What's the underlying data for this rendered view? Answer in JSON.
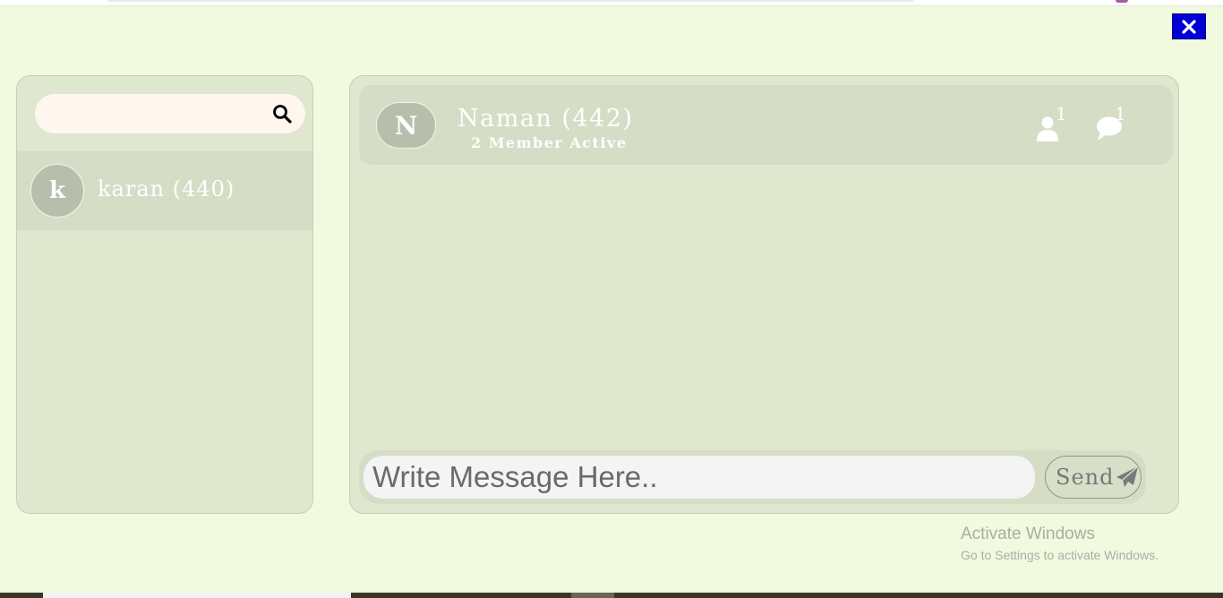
{
  "close_button": {
    "icon": "close-icon"
  },
  "sidebar": {
    "search": {
      "placeholder": "",
      "value": "",
      "icon": "search-icon"
    },
    "contacts": [
      {
        "initial": "k",
        "name": "karan (440)"
      }
    ]
  },
  "chat": {
    "header": {
      "initial": "N",
      "title": "Naman (442)",
      "subtitle": "2 Member Active",
      "members_count": "1",
      "messages_count": "1"
    },
    "composer": {
      "placeholder": "Write Message Here..",
      "value": "",
      "send_label": "Send",
      "send_icon": "paper-plane-icon"
    }
  },
  "watermark": {
    "title": "Activate Windows",
    "subtitle": "Go to Settings to activate Windows."
  },
  "colors": {
    "background": "#f1f9df",
    "panel": "#e0e7cf",
    "close_button": "#0000d6"
  }
}
